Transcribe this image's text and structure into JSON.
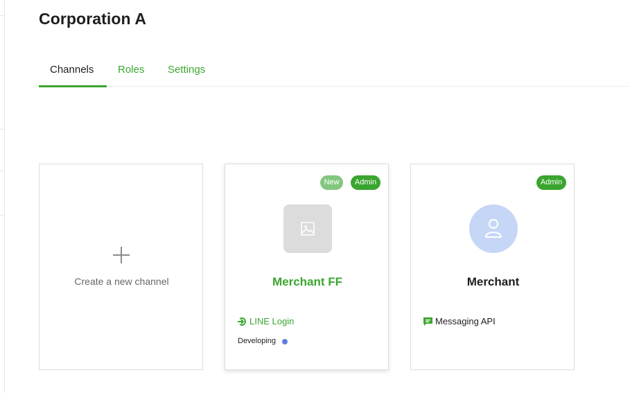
{
  "page": {
    "title": "Corporation A"
  },
  "tabs": [
    {
      "label": "Channels",
      "active": true
    },
    {
      "label": "Roles",
      "active": false
    },
    {
      "label": "Settings",
      "active": false
    }
  ],
  "create_card": {
    "label": "Create a new channel",
    "icon": "plus-icon"
  },
  "channels": [
    {
      "name": "Merchant FF",
      "badges": [
        "New",
        "Admin"
      ],
      "thumbnail_icon": "image-placeholder-icon",
      "type_icon": "line-login-icon",
      "type_label": "LINE Login",
      "status": "Developing",
      "status_color": "#5b7fe0"
    },
    {
      "name": "Merchant",
      "badges": [
        "Admin"
      ],
      "thumbnail_icon": "user-avatar-icon",
      "type_icon": "chat-bubble-icon",
      "type_label": "Messaging API"
    }
  ],
  "colors": {
    "accent": "#3aa52e",
    "badge_new": "#82c77f",
    "avatar_bg": "#c6d6f7"
  }
}
